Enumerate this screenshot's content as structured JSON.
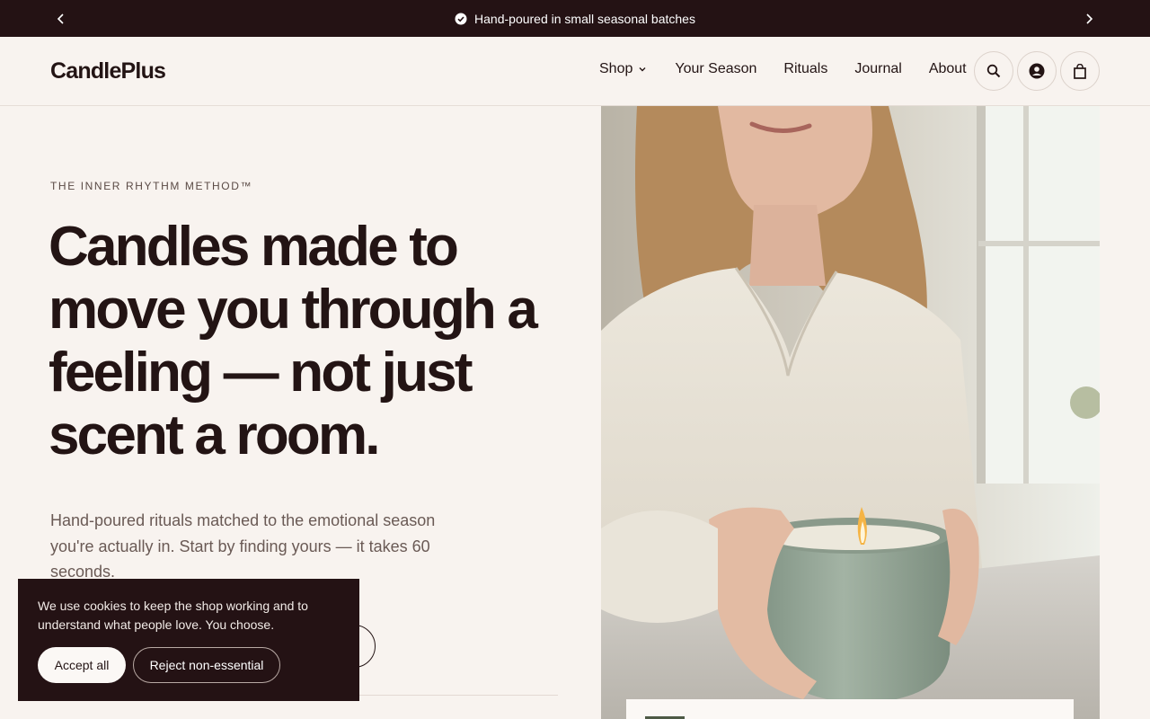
{
  "announcement": {
    "message": "Hand-poured in small seasonal batches",
    "prev_icon": "chevron-left-icon",
    "next_icon": "chevron-right-icon",
    "check_icon": "check-badge-icon"
  },
  "header": {
    "logo": "CandlePlus",
    "nav": {
      "shop": "Shop",
      "your_season": "Your Season",
      "rituals": "Rituals",
      "journal": "Journal",
      "about": "About"
    },
    "icons": [
      "search-icon",
      "account-icon",
      "bag-icon"
    ]
  },
  "hero": {
    "eyebrow": "THE INNER RHYTHM METHOD™",
    "headline": "Candles made to move you through a feeling — not just scent a room.",
    "subcopy": "Hand-poured rituals matched to the emotional season you're actually in. Start by finding yours — it takes 60 seconds."
  },
  "cookie_banner": {
    "text": "We use cookies to keep the shop working and to understand what people love. You choose.",
    "accept_label": "Accept all",
    "reject_label": "Reject non-essential"
  },
  "colors": {
    "dark": "#241214",
    "background": "#f8f3ef",
    "text": "#231414",
    "muted": "#6a5a55",
    "candle_green": "#9aab9b"
  }
}
